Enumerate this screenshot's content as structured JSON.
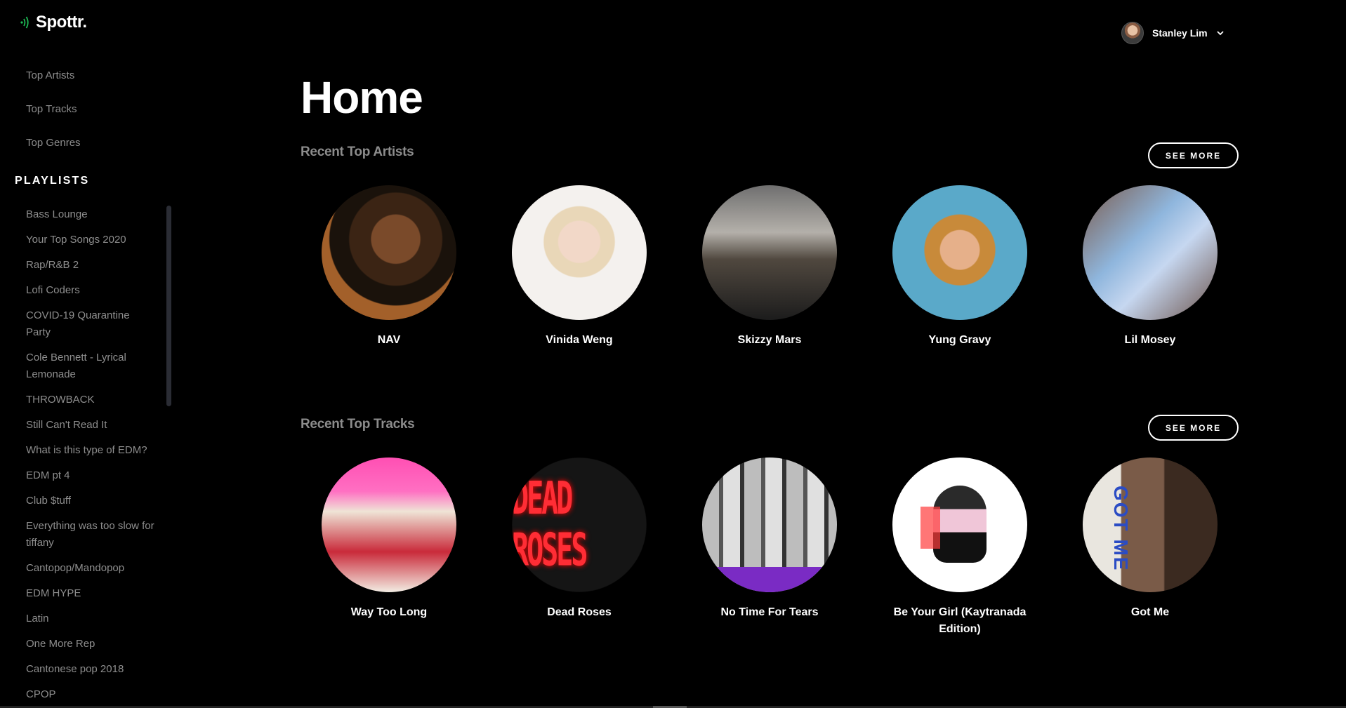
{
  "app": {
    "name": "Spottr."
  },
  "sidebar": {
    "nav": [
      "Top Artists",
      "Top Tracks",
      "Top Genres"
    ],
    "playlists_heading": "PLAYLISTS",
    "playlists": [
      "Bass Lounge",
      "Your Top Songs 2020",
      "Rap/R&B 2",
      "Lofi Coders",
      "COVID-19 Quarantine Party",
      "Cole Bennett - Lyrical Lemonade",
      "THROWBACK",
      "Still Can't Read It",
      "What is this type of EDM?",
      "EDM pt 4",
      "Club $tuff",
      "Everything was too slow for tiffany",
      "Cantopop/Mandopop",
      "EDM HYPE",
      "Latin",
      "One More Rep",
      "Cantonese pop 2018",
      "CPOP"
    ]
  },
  "header": {
    "user_name": "Stanley Lim"
  },
  "main": {
    "title": "Home",
    "artists_section": {
      "title": "Recent Top Artists",
      "see_more": "SEE MORE",
      "items": [
        "NAV",
        "Vinida Weng",
        "Skizzy Mars",
        "Yung Gravy",
        "Lil Mosey"
      ]
    },
    "tracks_section": {
      "title": "Recent Top Tracks",
      "see_more": "SEE MORE",
      "items": [
        "Way Too Long",
        "Dead Roses",
        "No Time For Tears",
        "Be Your Girl (Kaytranada Edition)",
        "Got Me"
      ],
      "art_text": {
        "dead_roses": "DEAD ROSES",
        "got_me": "GOT ME"
      }
    }
  },
  "colors": {
    "background": "#000000",
    "accent": "#1db954",
    "muted_text": "#8e8e8e"
  }
}
